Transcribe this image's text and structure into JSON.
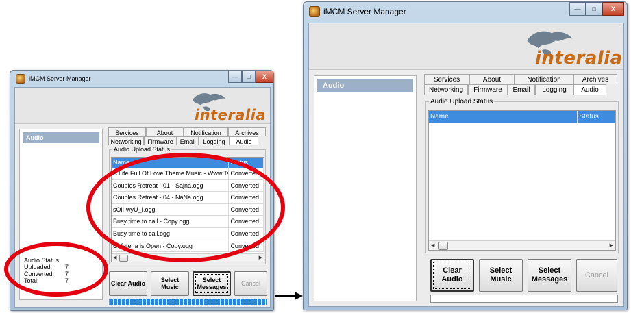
{
  "window_left": {
    "title": "iMCM Server Manager",
    "brand": "interalia",
    "side_header": "Audio",
    "tabs_row1": [
      "Services",
      "About",
      "Notification",
      "Archives"
    ],
    "tabs_row2": [
      "Networking",
      "Firmware",
      "Email",
      "Logging",
      "Audio"
    ],
    "group_label": "Audio Upload Status",
    "columns": [
      "Name",
      "Status"
    ],
    "rows": [
      {
        "name": "A Life Full Of Love Theme Music - Www.TamilKey.Co",
        "status": "Converted"
      },
      {
        "name": "Couples Retreat - 01 - Sajna.ogg",
        "status": "Converted"
      },
      {
        "name": "Couples Retreat - 04 - NaNa.ogg",
        "status": "Converted"
      },
      {
        "name": "sOlI-wyU_I.ogg",
        "status": "Converted"
      },
      {
        "name": "Busy time to call - Copy.ogg",
        "status": "Converted"
      },
      {
        "name": "Busy time to call.ogg",
        "status": "Converted"
      },
      {
        "name": "Cafeteria is Open - Copy.ogg",
        "status": "Converted"
      }
    ],
    "audio_status": {
      "heading": "Audio Status",
      "uploaded_label": "Uploaded:",
      "uploaded": "7",
      "converted_label": "Converted:",
      "converted": "7",
      "total_label": "Total:",
      "total": "7"
    },
    "buttons": {
      "clear": "Clear Audio",
      "music": "Select\nMusic",
      "messages": "Select\nMessages",
      "cancel": "Cancel"
    },
    "progress": 1.0
  },
  "window_right": {
    "title": "iMCM Server Manager",
    "brand": "interalia",
    "side_header": "Audio",
    "tabs_row1": [
      "Services",
      "About",
      "Notification",
      "Archives"
    ],
    "tabs_row2": [
      "Networking",
      "Firmware",
      "Email",
      "Logging",
      "Audio"
    ],
    "group_label": "Audio Upload Status",
    "columns": [
      "Name",
      "Status"
    ],
    "buttons": {
      "clear": "Clear Audio",
      "music": "Select\nMusic",
      "messages": "Select\nMessages",
      "cancel": "Cancel"
    },
    "progress": 0.0
  },
  "icons": {
    "minimize": "minimize-icon",
    "maximize": "maximize-icon",
    "close": "close-icon",
    "arrow": "right-arrow-icon"
  },
  "colors": {
    "highlight": "#e3000f",
    "selection": "#3d8ce0",
    "brand": "#c86a14"
  }
}
